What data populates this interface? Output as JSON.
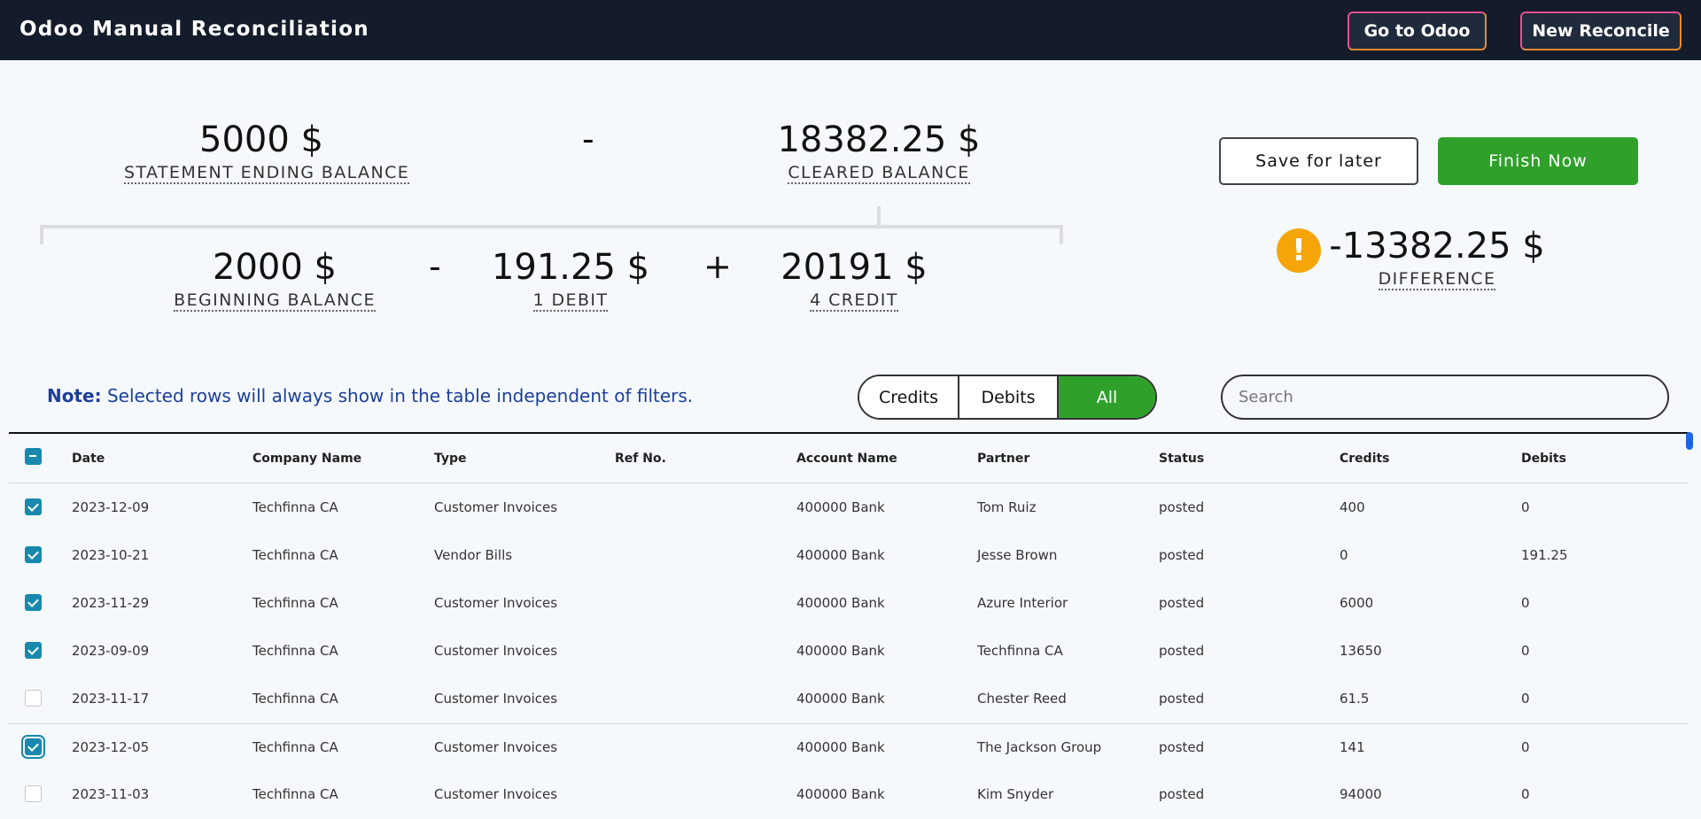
{
  "header": {
    "title": "Odoo Manual Reconciliation",
    "go_to_odoo": "Go to Odoo",
    "new_reconcile": "New Reconcile"
  },
  "summary": {
    "statement_ending_balance": {
      "value": "5000 $",
      "label": "Statement ending balance"
    },
    "minus_top": "-",
    "cleared_balance": {
      "value": "18382.25 $",
      "label": "Cleared balance"
    },
    "beginning_balance": {
      "value": "2000 $",
      "label": "Beginning balance"
    },
    "minus_bottom": "-",
    "debit": {
      "value": "191.25 $",
      "label": "1 Debit"
    },
    "plus": "+",
    "credit": {
      "value": "20191 $",
      "label": "4 Credit"
    },
    "difference": {
      "value": "-13382.25 $",
      "label": "Difference",
      "icon": "warning-icon"
    }
  },
  "actions": {
    "save_for_later": "Save for later",
    "finish_now": "Finish Now"
  },
  "colors": {
    "header_bg": "#141c2c",
    "accent_green": "#2fa12a",
    "warning": "#f5a508",
    "note_blue": "#1d3f9a",
    "checkbox": "#1889ad"
  },
  "filters": {
    "note_bold": "Note:",
    "note_text": " Selected rows will always show in the table independent of filters.",
    "credits": "Credits",
    "debits": "Debits",
    "all": "All",
    "active": "All",
    "search_placeholder": "Search",
    "search_value": ""
  },
  "table": {
    "columns": [
      "Date",
      "Company Name",
      "Type",
      "Ref No.",
      "Account Name",
      "Partner",
      "Status",
      "Credits",
      "Debits"
    ],
    "select_all_state": "indeterminate",
    "rows": [
      {
        "checked": true,
        "date": "2023-12-09",
        "company": "Techfinna CA",
        "type": "Customer Invoices",
        "ref": "",
        "account": "400000 Bank",
        "partner": "Tom Ruiz",
        "status": "posted",
        "credits": "400",
        "debits": "0"
      },
      {
        "checked": true,
        "date": "2023-10-21",
        "company": "Techfinna CA",
        "type": "Vendor Bills",
        "ref": "",
        "account": "400000 Bank",
        "partner": "Jesse Brown",
        "status": "posted",
        "credits": "0",
        "debits": "191.25"
      },
      {
        "checked": true,
        "date": "2023-11-29",
        "company": "Techfinna CA",
        "type": "Customer Invoices",
        "ref": "",
        "account": "400000 Bank",
        "partner": "Azure Interior",
        "status": "posted",
        "credits": "6000",
        "debits": "0"
      },
      {
        "checked": true,
        "date": "2023-09-09",
        "company": "Techfinna CA",
        "type": "Customer Invoices",
        "ref": "",
        "account": "400000 Bank",
        "partner": "Techfinna CA",
        "status": "posted",
        "credits": "13650",
        "debits": "0"
      },
      {
        "checked": false,
        "date": "2023-11-17",
        "company": "Techfinna CA",
        "type": "Customer Invoices",
        "ref": "",
        "account": "400000 Bank",
        "partner": "Chester Reed",
        "status": "posted",
        "credits": "61.5",
        "debits": "0"
      },
      {
        "checked": true,
        "date": "2023-12-05",
        "company": "Techfinna CA",
        "type": "Customer Invoices",
        "ref": "",
        "account": "400000 Bank",
        "partner": "The Jackson Group",
        "status": "posted",
        "credits": "141",
        "debits": "0"
      },
      {
        "checked": false,
        "date": "2023-11-03",
        "company": "Techfinna CA",
        "type": "Customer Invoices",
        "ref": "",
        "account": "400000 Bank",
        "partner": "Kim Snyder",
        "status": "posted",
        "credits": "94000",
        "debits": "0"
      }
    ]
  }
}
